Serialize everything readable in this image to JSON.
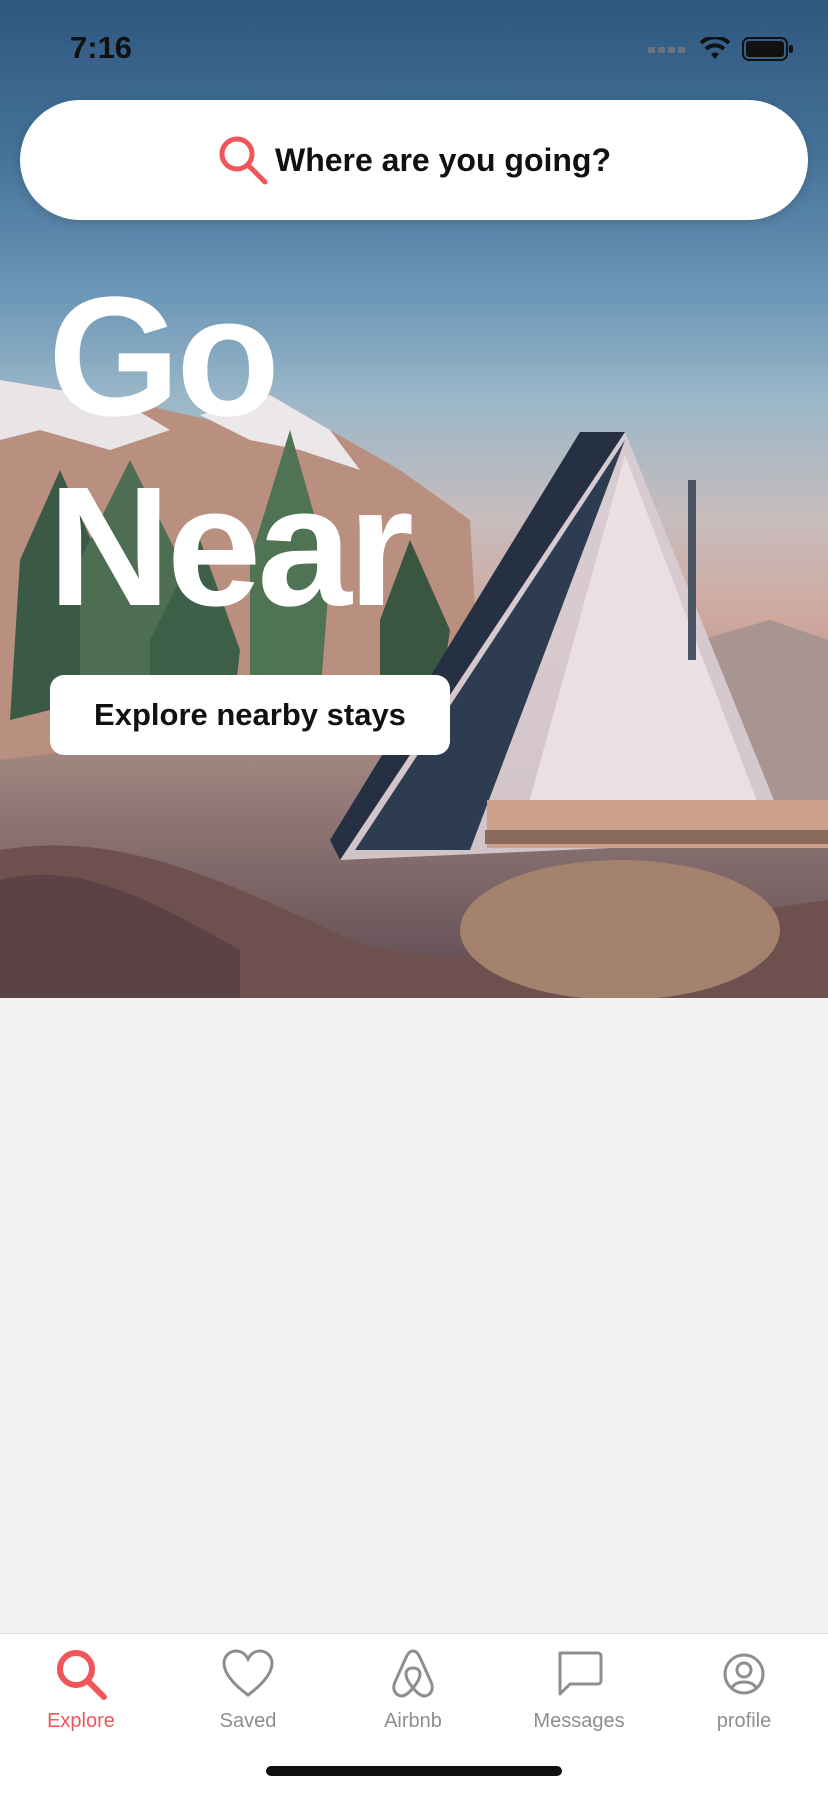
{
  "status_bar": {
    "time": "7:16"
  },
  "search": {
    "placeholder": "Where are you going?",
    "icon": "search-icon"
  },
  "hero": {
    "title_line1": "Go",
    "title_line2": "Near",
    "button_label": "Explore nearby stays"
  },
  "tabbar": {
    "items": [
      {
        "label": "Explore",
        "icon": "search-icon",
        "active": true
      },
      {
        "label": "Saved",
        "icon": "heart-icon",
        "active": false
      },
      {
        "label": "Airbnb",
        "icon": "airbnb-logo-icon",
        "active": false
      },
      {
        "label": "Messages",
        "icon": "message-icon",
        "active": false
      },
      {
        "label": "profile",
        "icon": "profile-icon",
        "active": false
      }
    ]
  },
  "colors": {
    "accent": "#F0555A",
    "background": "#F2F2F2",
    "inactive": "#8E8E8E"
  }
}
